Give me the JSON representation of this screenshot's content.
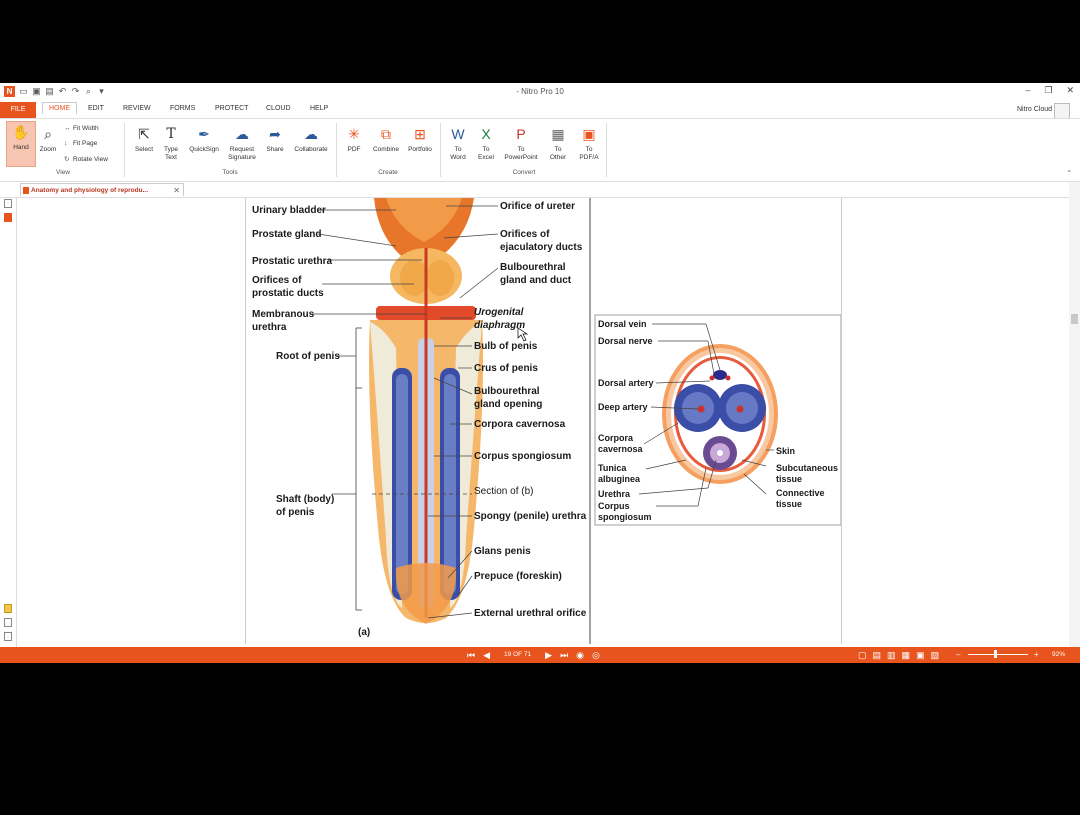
{
  "app": {
    "title": "- Nitro Pro 10",
    "cloud_label": "Nitro Cloud"
  },
  "menu": {
    "file": "FILE",
    "tabs": [
      "HOME",
      "EDIT",
      "REVIEW",
      "FORMS",
      "PROTECT",
      "CLOUD",
      "HELP"
    ]
  },
  "ribbon": {
    "view": {
      "hand": "Hand",
      "zoom": "Zoom",
      "fit_width": "Fit Width",
      "fit_page": "Fit Page",
      "rotate_view": "Rotate View",
      "group": "View"
    },
    "tools": {
      "select": "Select",
      "type_text": [
        "Type",
        "Text"
      ],
      "quicksign": "QuickSign",
      "request_signature": [
        "Request",
        "Signature"
      ],
      "share": "Share",
      "collaborate": "Collaborate",
      "group": "Tools"
    },
    "create": {
      "pdf": "PDF",
      "combine": "Combine",
      "portfolio": "Portfolio",
      "group": "Create"
    },
    "convert": {
      "to_word": [
        "To",
        "Word"
      ],
      "to_excel": [
        "To",
        "Excel"
      ],
      "to_powerpoint": [
        "To",
        "PowerPoint"
      ],
      "to_other": [
        "To",
        "Other"
      ],
      "to_pdfa": [
        "To",
        "PDF/A"
      ],
      "group": "Convert"
    }
  },
  "document": {
    "tab_title": "Anatomy and physiology of reprodu..."
  },
  "figure_a": {
    "labels_left": [
      "Urinary bladder",
      "Prostate gland",
      "Prostatic urethra",
      "Orifices of",
      "prostatic ducts",
      "Membranous",
      "urethra",
      "Root of penis",
      "Shaft (body)",
      "of penis"
    ],
    "labels_right": [
      "Orifice of ureter",
      "Orifices of",
      "ejaculatory ducts",
      "Bulbourethral",
      "gland and duct",
      "Urogenital",
      "diaphragm",
      "Bulb of penis",
      "Crus of penis",
      "Bulbourethral",
      "gland opening",
      "Corpora cavernosa",
      "Corpus spongiosum",
      "Section of (b)",
      "Spongy (penile) urethra",
      "Glans penis",
      "Prepuce (foreskin)",
      "External urethral orifice"
    ],
    "caption": "(a)"
  },
  "figure_b": {
    "labels_left": [
      "Dorsal vein",
      "Dorsal nerve",
      "Dorsal artery",
      "Deep artery",
      "Corpora",
      "cavernosa",
      "Tunica",
      "albuginea",
      "Urethra",
      "Corpus",
      "spongiosum"
    ],
    "labels_right": [
      "Skin",
      "Subcutaneous",
      "tissue",
      "Connective",
      "tissue"
    ]
  },
  "status": {
    "page_indicator": "19 OF 71",
    "zoom_percent": "92%"
  },
  "colors": {
    "accent": "#e8541e",
    "tissue_orange": "#f2a04a",
    "erectile_blue": "#3a4ea8"
  }
}
